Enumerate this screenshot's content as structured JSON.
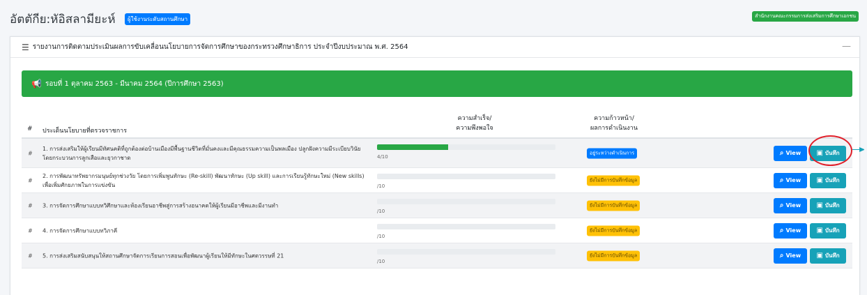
{
  "header": {
    "title": "อัตตักีย:หัอิสลามียะห์",
    "role_badge": "ผู้ใช้งานระดับสถานศึกษา",
    "org_badge": "สำนักงานคณะกรรมการส่งเสริมการศึกษาเอกชน"
  },
  "card": {
    "title": "รายงานการติดตามประเมินผลการขับเคลื่อนนโยบายการจัดการศึกษาของกระทรวงศึกษาธิการ ประจำปีงบประมาณ พ.ศ. 2564",
    "collapse": "—"
  },
  "banner": {
    "text": "รอบที่ 1 ตุลาคม 2563 - มีนาคม 2564 (ปีการศึกษา 2563)"
  },
  "table": {
    "headers": {
      "hash": "#",
      "issue": "ประเด็นนโยบายที่ตรวจราชการ",
      "success_1": "ความสำเร็จ/",
      "success_2": "ความพึงพอใจ",
      "progress_1": "ความก้าวหน้า/",
      "progress_2": "ผลการดำเนินงาน"
    },
    "rows": [
      {
        "hash": "#",
        "issue": "1. การส่งเสริมให้ผู้เรียนมีทัศนคติที่ถูกต้องต่อบ้านเมืองมีพื้นฐานชีวิตที่มั่นคงและมีคุณธรรมความเป็นพลเมือง ปลูกฝังความมีระเบียบวินัย โดยกระบวนการลูกเสือและยุวกาชาด",
        "score": "4/10",
        "progress": 0.4,
        "status": "อยู่ระหว่างดำเนินการ",
        "status_color": "#007bff"
      },
      {
        "hash": "#",
        "issue": "2. การพัฒนาทรัพยากรมนุษย์ทุกช่วงวัย โดยการเพิ่มพูนทักษะ (Re-skill) พัฒนาทักษะ (Up skill) และการเรียนรู้ทักษะใหม่ (New skills) เพื่อเพิ่มศักยภาพในการแข่งขัน",
        "score": "/10",
        "progress": 0,
        "status": "ยังไม่มีการบันทึกข้อมูล",
        "status_color": "#ffc107"
      },
      {
        "hash": "#",
        "issue": "3. การจัดการศึกษาแบบทวิศึกษาและห้องเรียนอาชีพสู่การสร้างอนาคตให้ผู้เรียนมีอาชีพและมีงานทำ",
        "score": "/10",
        "progress": 0,
        "status": "ยังไม่มีการบันทึกข้อมูล",
        "status_color": "#ffc107"
      },
      {
        "hash": "#",
        "issue": "4. การจัดการศึกษาแบบทวิภาคี",
        "score": "/10",
        "progress": 0,
        "status": "ยังไม่มีการบันทึกข้อมูล",
        "status_color": "#ffc107"
      },
      {
        "hash": "#",
        "issue": "5. การส่งเสริมสนับสนุนให้สถานศึกษาจัดการเรียนการสอนเพื่อพัฒนาผู้เรียนให้มีทักษะในศตวรรษที่ 21",
        "score": "/10",
        "progress": 0,
        "status": "ยังไม่มีการบันทึกข้อมูล",
        "status_color": "#ffc107"
      }
    ],
    "view_label": "View",
    "save_label": "บันทึก"
  },
  "icons": {
    "search": "search-icon",
    "save": "floppy-disk-icon",
    "list": "list-icon",
    "megaphone": "megaphone-icon"
  }
}
